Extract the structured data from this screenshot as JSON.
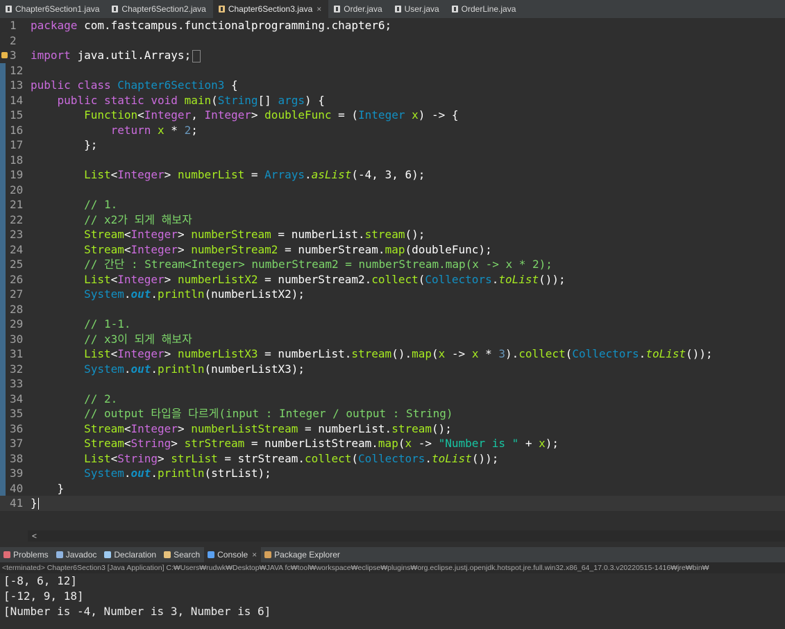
{
  "editor_tabs": [
    {
      "label": "Chapter6Section1.java",
      "active": false
    },
    {
      "label": "Chapter6Section2.java",
      "active": false
    },
    {
      "label": "Chapter6Section3.java",
      "active": true
    },
    {
      "label": "Order.java",
      "active": false
    },
    {
      "label": "User.java",
      "active": false
    },
    {
      "label": "OrderLine.java",
      "active": false
    }
  ],
  "tab_close_glyph": "×",
  "code_lines": [
    {
      "n": "1",
      "tokens": [
        {
          "t": "package ",
          "c": "kw"
        },
        {
          "t": "com.fastcampus.functionalprogramming.chapter6;",
          "c": "pk"
        }
      ]
    },
    {
      "n": "2",
      "tokens": []
    },
    {
      "n": "3",
      "fold": true,
      "warn": true,
      "tokens": [
        {
          "t": "import ",
          "c": "kw"
        },
        {
          "t": "java.util.Arrays;",
          "c": "pk"
        }
      ],
      "folded_box": true
    },
    {
      "n": "12",
      "tokens": []
    },
    {
      "n": "13",
      "tokens": [
        {
          "t": "public class ",
          "c": "kw"
        },
        {
          "t": "Chapter6Section3 ",
          "c": "ty"
        },
        {
          "t": "{",
          "c": "pk"
        }
      ]
    },
    {
      "n": "14",
      "fold": true,
      "tokens": [
        {
          "t": "    public static void ",
          "c": "kw"
        },
        {
          "t": "main",
          "c": "fn"
        },
        {
          "t": "(",
          "c": "pk"
        },
        {
          "t": "String",
          "c": "ty"
        },
        {
          "t": "[] ",
          "c": "pk"
        },
        {
          "t": "args",
          "c": "ty"
        },
        {
          "t": ") {",
          "c": "pk"
        }
      ]
    },
    {
      "n": "15",
      "tokens": [
        {
          "t": "        Function",
          "c": "fn"
        },
        {
          "t": "<",
          "c": "pk"
        },
        {
          "t": "Integer",
          "c": "kw"
        },
        {
          "t": ", ",
          "c": "pk"
        },
        {
          "t": "Integer",
          "c": "kw"
        },
        {
          "t": "> ",
          "c": "pk"
        },
        {
          "t": "doubleFunc",
          "c": "fn"
        },
        {
          "t": " = (",
          "c": "pk"
        },
        {
          "t": "Integer ",
          "c": "ty"
        },
        {
          "t": "x",
          "c": "fn"
        },
        {
          "t": ") -> {",
          "c": "pk"
        }
      ]
    },
    {
      "n": "16",
      "tokens": [
        {
          "t": "            return ",
          "c": "kw"
        },
        {
          "t": "x",
          "c": "fn"
        },
        {
          "t": " * ",
          "c": "pk"
        },
        {
          "t": "2",
          "c": "nm"
        },
        {
          "t": ";",
          "c": "pk"
        }
      ]
    },
    {
      "n": "17",
      "tokens": [
        {
          "t": "        };",
          "c": "pk"
        }
      ]
    },
    {
      "n": "18",
      "tokens": []
    },
    {
      "n": "19",
      "tokens": [
        {
          "t": "        List",
          "c": "fn"
        },
        {
          "t": "<",
          "c": "pk"
        },
        {
          "t": "Integer",
          "c": "kw"
        },
        {
          "t": "> ",
          "c": "pk"
        },
        {
          "t": "numberList",
          "c": "fn"
        },
        {
          "t": " = ",
          "c": "pk"
        },
        {
          "t": "Arrays",
          "c": "ty"
        },
        {
          "t": ".",
          "c": "pk"
        },
        {
          "t": "asList",
          "c": "fn it"
        },
        {
          "t": "(-4, 3, 6);",
          "c": "pk"
        }
      ]
    },
    {
      "n": "20",
      "tokens": []
    },
    {
      "n": "21",
      "tokens": [
        {
          "t": "        // 1.",
          "c": "cm"
        }
      ]
    },
    {
      "n": "22",
      "tokens": [
        {
          "t": "        // x2가 되게 해보자",
          "c": "cm"
        }
      ]
    },
    {
      "n": "23",
      "tokens": [
        {
          "t": "        Stream",
          "c": "fn"
        },
        {
          "t": "<",
          "c": "pk"
        },
        {
          "t": "Integer",
          "c": "kw"
        },
        {
          "t": "> ",
          "c": "pk"
        },
        {
          "t": "numberStream",
          "c": "fn"
        },
        {
          "t": " = numberList.",
          "c": "pk"
        },
        {
          "t": "stream",
          "c": "fn"
        },
        {
          "t": "();",
          "c": "pk"
        }
      ]
    },
    {
      "n": "24",
      "tokens": [
        {
          "t": "        Stream",
          "c": "fn"
        },
        {
          "t": "<",
          "c": "pk"
        },
        {
          "t": "Integer",
          "c": "kw"
        },
        {
          "t": "> ",
          "c": "pk"
        },
        {
          "t": "numberStream2",
          "c": "fn"
        },
        {
          "t": " = numberStream.",
          "c": "pk"
        },
        {
          "t": "map",
          "c": "fn"
        },
        {
          "t": "(doubleFunc);",
          "c": "pk"
        }
      ]
    },
    {
      "n": "25",
      "tokens": [
        {
          "t": "        // 간단 : Stream<Integer> numberStream2 = numberStream.map(x -> x * 2);",
          "c": "cm"
        }
      ]
    },
    {
      "n": "26",
      "tokens": [
        {
          "t": "        List",
          "c": "fn"
        },
        {
          "t": "<",
          "c": "pk"
        },
        {
          "t": "Integer",
          "c": "kw"
        },
        {
          "t": "> ",
          "c": "pk"
        },
        {
          "t": "numberListX2",
          "c": "fn"
        },
        {
          "t": " = numberStream2.",
          "c": "pk"
        },
        {
          "t": "collect",
          "c": "fn"
        },
        {
          "t": "(",
          "c": "pk"
        },
        {
          "t": "Collectors",
          "c": "ty"
        },
        {
          "t": ".",
          "c": "pk"
        },
        {
          "t": "toList",
          "c": "fn it"
        },
        {
          "t": "());",
          "c": "pk"
        }
      ]
    },
    {
      "n": "27",
      "tokens": [
        {
          "t": "        System",
          "c": "ty"
        },
        {
          "t": ".",
          "c": "pk"
        },
        {
          "t": "out",
          "c": "ty it bo"
        },
        {
          "t": ".",
          "c": "pk"
        },
        {
          "t": "println",
          "c": "fn"
        },
        {
          "t": "(numberListX2);",
          "c": "pk"
        }
      ]
    },
    {
      "n": "28",
      "tokens": []
    },
    {
      "n": "29",
      "tokens": [
        {
          "t": "        // 1-1.",
          "c": "cm"
        }
      ]
    },
    {
      "n": "30",
      "tokens": [
        {
          "t": "        // x3이 되게 해보자",
          "c": "cm"
        }
      ]
    },
    {
      "n": "31",
      "tokens": [
        {
          "t": "        List",
          "c": "fn"
        },
        {
          "t": "<",
          "c": "pk"
        },
        {
          "t": "Integer",
          "c": "kw"
        },
        {
          "t": "> ",
          "c": "pk"
        },
        {
          "t": "numberListX3",
          "c": "fn"
        },
        {
          "t": " = numberList.",
          "c": "pk"
        },
        {
          "t": "stream",
          "c": "fn"
        },
        {
          "t": "().",
          "c": "pk"
        },
        {
          "t": "map",
          "c": "fn"
        },
        {
          "t": "(",
          "c": "pk"
        },
        {
          "t": "x",
          "c": "fn"
        },
        {
          "t": " -> ",
          "c": "pk"
        },
        {
          "t": "x",
          "c": "fn"
        },
        {
          "t": " * ",
          "c": "pk"
        },
        {
          "t": "3",
          "c": "nm"
        },
        {
          "t": ").",
          "c": "pk"
        },
        {
          "t": "collect",
          "c": "fn"
        },
        {
          "t": "(",
          "c": "pk"
        },
        {
          "t": "Collectors",
          "c": "ty"
        },
        {
          "t": ".",
          "c": "pk"
        },
        {
          "t": "toList",
          "c": "fn it"
        },
        {
          "t": "());",
          "c": "pk"
        }
      ]
    },
    {
      "n": "32",
      "tokens": [
        {
          "t": "        System",
          "c": "ty"
        },
        {
          "t": ".",
          "c": "pk"
        },
        {
          "t": "out",
          "c": "ty it bo"
        },
        {
          "t": ".",
          "c": "pk"
        },
        {
          "t": "println",
          "c": "fn"
        },
        {
          "t": "(numberListX3);",
          "c": "pk"
        }
      ]
    },
    {
      "n": "33",
      "tokens": []
    },
    {
      "n": "34",
      "tokens": [
        {
          "t": "        // 2.",
          "c": "cm"
        }
      ]
    },
    {
      "n": "35",
      "tokens": [
        {
          "t": "        // output 타입을 다르게(input : Integer / output : String)",
          "c": "cm"
        }
      ]
    },
    {
      "n": "36",
      "tokens": [
        {
          "t": "        Stream",
          "c": "fn"
        },
        {
          "t": "<",
          "c": "pk"
        },
        {
          "t": "Integer",
          "c": "kw"
        },
        {
          "t": "> ",
          "c": "pk"
        },
        {
          "t": "numberListStream",
          "c": "fn"
        },
        {
          "t": " = numberList.",
          "c": "pk"
        },
        {
          "t": "stream",
          "c": "fn"
        },
        {
          "t": "();",
          "c": "pk"
        }
      ]
    },
    {
      "n": "37",
      "tokens": [
        {
          "t": "        Stream",
          "c": "fn"
        },
        {
          "t": "<",
          "c": "pk"
        },
        {
          "t": "String",
          "c": "kw"
        },
        {
          "t": "> ",
          "c": "pk"
        },
        {
          "t": "strStream",
          "c": "fn"
        },
        {
          "t": " = numberListStream.",
          "c": "pk"
        },
        {
          "t": "map",
          "c": "fn"
        },
        {
          "t": "(",
          "c": "pk"
        },
        {
          "t": "x",
          "c": "fn"
        },
        {
          "t": " -> ",
          "c": "pk"
        },
        {
          "t": "\"Number is \"",
          "c": "st"
        },
        {
          "t": " + ",
          "c": "pk"
        },
        {
          "t": "x",
          "c": "fn"
        },
        {
          "t": ");",
          "c": "pk"
        }
      ]
    },
    {
      "n": "38",
      "tokens": [
        {
          "t": "        List",
          "c": "fn"
        },
        {
          "t": "<",
          "c": "pk"
        },
        {
          "t": "String",
          "c": "kw"
        },
        {
          "t": "> ",
          "c": "pk"
        },
        {
          "t": "strList",
          "c": "fn"
        },
        {
          "t": " = strStream.",
          "c": "pk"
        },
        {
          "t": "collect",
          "c": "fn"
        },
        {
          "t": "(",
          "c": "pk"
        },
        {
          "t": "Collectors",
          "c": "ty"
        },
        {
          "t": ".",
          "c": "pk"
        },
        {
          "t": "toList",
          "c": "fn it"
        },
        {
          "t": "());",
          "c": "pk"
        }
      ]
    },
    {
      "n": "39",
      "tokens": [
        {
          "t": "        System",
          "c": "ty"
        },
        {
          "t": ".",
          "c": "pk"
        },
        {
          "t": "out",
          "c": "ty it bo"
        },
        {
          "t": ".",
          "c": "pk"
        },
        {
          "t": "println",
          "c": "fn"
        },
        {
          "t": "(strList);",
          "c": "pk"
        }
      ]
    },
    {
      "n": "40",
      "tokens": [
        {
          "t": "    }",
          "c": "pk"
        }
      ]
    },
    {
      "n": "41",
      "current": true,
      "tokens": [
        {
          "t": "}",
          "c": "pk"
        }
      ]
    }
  ],
  "hscroll_arrow": "<",
  "view_tabs": [
    {
      "label": "Problems",
      "icon": "problems-icon",
      "color": "#e06c75",
      "active": false
    },
    {
      "label": "Javadoc",
      "icon": "javadoc-icon",
      "color": "#8fb4e0",
      "active": false
    },
    {
      "label": "Declaration",
      "icon": "declaration-icon",
      "color": "#9cc9f0",
      "active": false
    },
    {
      "label": "Search",
      "icon": "search-icon",
      "color": "#e5c07b",
      "active": false
    },
    {
      "label": "Console",
      "icon": "console-icon",
      "color": "#5aa0f0",
      "active": true
    },
    {
      "label": "Package Explorer",
      "icon": "package-explorer-icon",
      "color": "#d4a05a",
      "active": false
    }
  ],
  "launch_info": "<terminated> Chapter6Section3 [Java Application] C:₩Users₩rudwk₩Desktop₩JAVA fc₩tool₩workspace₩eclipse₩plugins₩org.eclipse.justj.openjdk.hotspot.jre.full.win32.x86_64_17.0.3.v20220515-1416₩jre₩bin₩",
  "console_output": [
    "[-8, 6, 12]",
    "[-12, 9, 18]",
    "[Number is -4, Number is 3, Number is 6]"
  ]
}
